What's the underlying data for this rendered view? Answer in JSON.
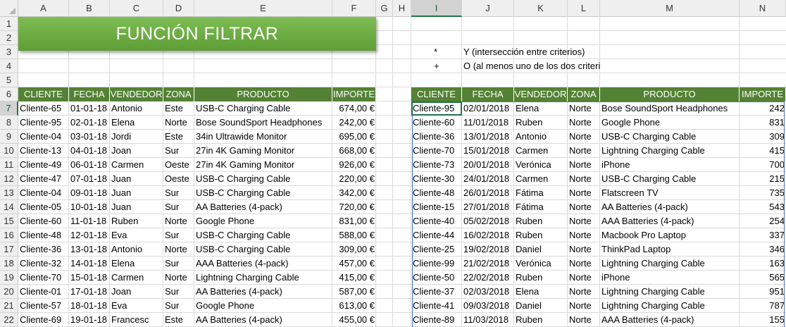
{
  "title": "FUNCIÓN FILTRAR",
  "columns": [
    "A",
    "B",
    "C",
    "D",
    "E",
    "F",
    "G",
    "H",
    "I",
    "J",
    "K",
    "L",
    "M",
    "N"
  ],
  "rows": [
    "1",
    "2",
    "3",
    "4",
    "5",
    "6",
    "7",
    "8",
    "9",
    "10",
    "11",
    "12",
    "13",
    "14",
    "15",
    "16",
    "17",
    "18",
    "19",
    "20",
    "21",
    "22"
  ],
  "legend": [
    {
      "symbol": "*",
      "text": "Y (intersección entre criterios)"
    },
    {
      "symbol": "+",
      "text": "O (al menos uno de los dos criterio"
    }
  ],
  "left_table": {
    "headers": [
      "CLIENTE",
      "FECHA",
      "VENDEDOR",
      "ZONA",
      "PRODUCTO",
      "IMPORTE"
    ],
    "rows": [
      [
        "Cliente-65",
        "01-01-18",
        "Antonio",
        "Este",
        "USB-C Charging Cable",
        "674,00 €"
      ],
      [
        "Cliente-95",
        "02-01-18",
        "Elena",
        "Norte",
        "Bose SoundSport Headphones",
        "242,00 €"
      ],
      [
        "Cliente-04",
        "03-01-18",
        "Jordi",
        "Este",
        "34in Ultrawide Monitor",
        "695,00 €"
      ],
      [
        "Cliente-13",
        "04-01-18",
        "Joan",
        "Sur",
        "27in 4K Gaming Monitor",
        "668,00 €"
      ],
      [
        "Cliente-49",
        "06-01-18",
        "Carmen",
        "Oeste",
        "27in 4K Gaming Monitor",
        "926,00 €"
      ],
      [
        "Cliente-47",
        "07-01-18",
        "Juan",
        "Oeste",
        "USB-C Charging Cable",
        "220,00 €"
      ],
      [
        "Cliente-04",
        "09-01-18",
        "Juan",
        "Sur",
        "USB-C Charging Cable",
        "342,00 €"
      ],
      [
        "Cliente-05",
        "10-01-18",
        "Juan",
        "Sur",
        "AA Batteries (4-pack)",
        "720,00 €"
      ],
      [
        "Cliente-60",
        "11-01-18",
        "Ruben",
        "Norte",
        "Google Phone",
        "831,00 €"
      ],
      [
        "Cliente-48",
        "12-01-18",
        "Eva",
        "Sur",
        "USB-C Charging Cable",
        "588,00 €"
      ],
      [
        "Cliente-36",
        "13-01-18",
        "Antonio",
        "Norte",
        "USB-C Charging Cable",
        "309,00 €"
      ],
      [
        "Cliente-32",
        "14-01-18",
        "Elena",
        "Sur",
        "AAA Batteries (4-pack)",
        "457,00 €"
      ],
      [
        "Cliente-70",
        "15-01-18",
        "Carmen",
        "Norte",
        "Lightning Charging Cable",
        "415,00 €"
      ],
      [
        "Cliente-01",
        "17-01-18",
        "Joan",
        "Sur",
        "AA Batteries (4-pack)",
        "587,00 €"
      ],
      [
        "Cliente-57",
        "18-01-18",
        "Eva",
        "Sur",
        "Google Phone",
        "613,00 €"
      ],
      [
        "Cliente-69",
        "19-01-18",
        "Francesc",
        "Este",
        "AA Batteries (4-pack)",
        "455,00 €"
      ]
    ]
  },
  "right_table": {
    "headers": [
      "CLIENTE",
      "FECHA",
      "VENDEDOR",
      "ZONA",
      "PRODUCTO",
      "IMPORTE"
    ],
    "rows": [
      [
        "Cliente-95",
        "02/01/2018",
        "Elena",
        "Norte",
        "Bose SoundSport Headphones",
        "242"
      ],
      [
        "Cliente-60",
        "11/01/2018",
        "Ruben",
        "Norte",
        "Google Phone",
        "831"
      ],
      [
        "Cliente-36",
        "13/01/2018",
        "Antonio",
        "Norte",
        "USB-C Charging Cable",
        "309"
      ],
      [
        "Cliente-70",
        "15/01/2018",
        "Carmen",
        "Norte",
        "Lightning Charging Cable",
        "415"
      ],
      [
        "Cliente-73",
        "20/01/2018",
        "Verónica",
        "Norte",
        "iPhone",
        "700"
      ],
      [
        "Cliente-30",
        "24/01/2018",
        "Carmen",
        "Norte",
        "USB-C Charging Cable",
        "215"
      ],
      [
        "Cliente-48",
        "26/01/2018",
        "Fátima",
        "Norte",
        "Flatscreen TV",
        "735"
      ],
      [
        "Cliente-15",
        "27/01/2018",
        "Fátima",
        "Norte",
        "AA Batteries (4-pack)",
        "543"
      ],
      [
        "Cliente-40",
        "05/02/2018",
        "Ruben",
        "Norte",
        "AAA Batteries (4-pack)",
        "254"
      ],
      [
        "Cliente-44",
        "16/02/2018",
        "Ruben",
        "Norte",
        "Macbook Pro Laptop",
        "337"
      ],
      [
        "Cliente-25",
        "19/02/2018",
        "Daniel",
        "Norte",
        "ThinkPad Laptop",
        "346"
      ],
      [
        "Cliente-99",
        "21/02/2018",
        "Verónica",
        "Norte",
        "Lightning Charging Cable",
        "163"
      ],
      [
        "Cliente-50",
        "22/02/2018",
        "Ruben",
        "Norte",
        "iPhone",
        "565"
      ],
      [
        "Cliente-37",
        "02/03/2018",
        "Elena",
        "Norte",
        "Lightning Charging Cable",
        "951"
      ],
      [
        "Cliente-41",
        "09/03/2018",
        "Daniel",
        "Norte",
        "Lightning Charging Cable",
        "787"
      ],
      [
        "Cliente-89",
        "11/03/2018",
        "Ruben",
        "Norte",
        "AAA Batteries (4-pack)",
        "155"
      ]
    ]
  },
  "colors": {
    "header_green": "#548235",
    "banner_green": "#70ad47",
    "selection_green": "#217346",
    "spill_border": "#4472c4"
  }
}
